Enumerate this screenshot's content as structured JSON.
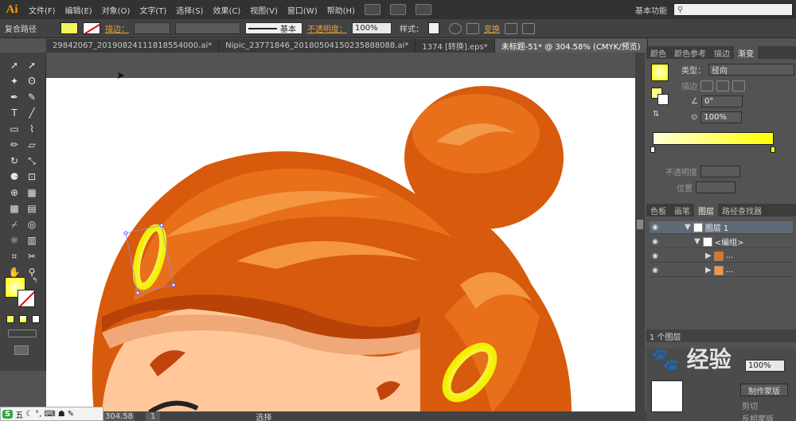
{
  "app": {
    "logo": "Ai"
  },
  "menu": {
    "items": [
      "文件(F)",
      "编辑(E)",
      "对象(O)",
      "文字(T)",
      "选择(S)",
      "效果(C)",
      "视图(V)",
      "窗口(W)",
      "帮助(H)"
    ],
    "workspace": "基本功能",
    "search_icon": "search-icon"
  },
  "control": {
    "selection_type": "复合路径",
    "stroke_label": "描边：",
    "stroke_style": "基本",
    "opacity_label": "不透明度：",
    "opacity_value": "100%",
    "style_label": "样式：",
    "transform_label": "变换",
    "fill_color": "#f5f55a",
    "accent_color": "#e6a23c"
  },
  "tabs": [
    {
      "label": "29842067_20190824111818554000.ai*",
      "active": false
    },
    {
      "label": "Nipic_23771846_20180504150235888088.ai*",
      "active": false
    },
    {
      "label": "1374 [转换].eps*",
      "active": false
    },
    {
      "label": "未标题-51* @ 304.58% (CMYK/预览)",
      "active": true
    }
  ],
  "gradient_panel": {
    "tabs": [
      "颜色",
      "颜色参考",
      "描边",
      "渐变"
    ],
    "active_tab": "渐变",
    "type_label": "类型：",
    "type_value": "径向",
    "stroke_label": "描边",
    "angle_value": "0°",
    "aspect_value": "100%",
    "opacity_label": "不透明度",
    "location_label": "位置",
    "start_color": "#ffffd8",
    "end_color": "#ffff00"
  },
  "layers_panel": {
    "tabs": [
      "色板",
      "画笔",
      "图层",
      "路径查找器"
    ],
    "active_tab": "图层",
    "rows": [
      {
        "name": "图层 1",
        "indent": 0
      },
      {
        "name": "<编组>",
        "indent": 1
      },
      {
        "name": "...",
        "indent": 2
      },
      {
        "name": "...",
        "indent": 2
      }
    ],
    "footer": "1 个图层"
  },
  "transparency_panel": {
    "opacity_value": "100%",
    "make_mask": "制作蒙版",
    "clip_label": "剪切",
    "invert_label": "反相蒙版"
  },
  "status": {
    "zoom_value": "304.58",
    "page_value": "1",
    "tool_name": "选择"
  },
  "taskbar": {
    "ime_label": "五"
  },
  "watermark": "经验"
}
